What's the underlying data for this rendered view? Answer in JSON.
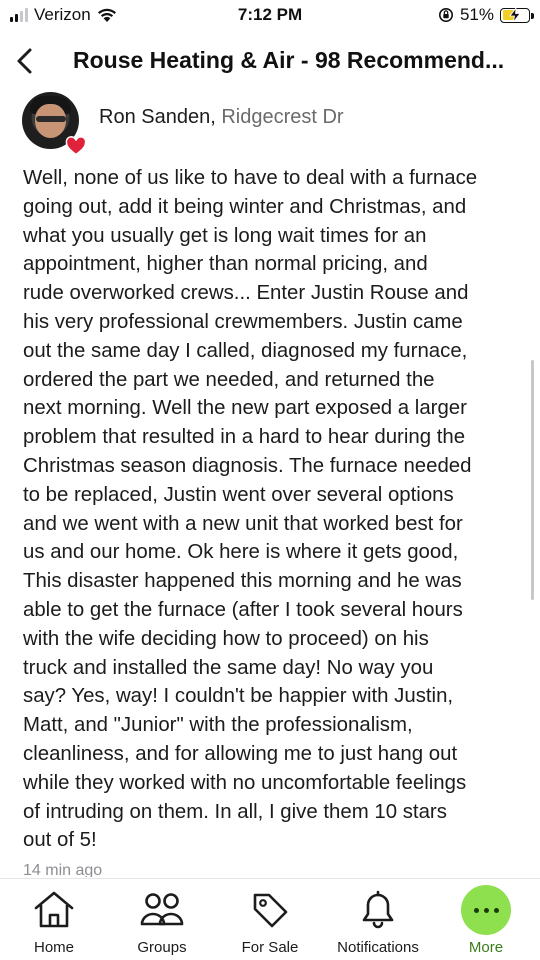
{
  "status_bar": {
    "carrier": "Verizon",
    "time": "7:12 PM",
    "battery_percent": "51%",
    "battery_level": 0.51,
    "signal_bars": 4,
    "signal_active": 2,
    "icons": [
      "signal-icon",
      "wifi-icon",
      "rotation-lock-icon",
      "battery-charging-icon"
    ]
  },
  "header": {
    "title": "Rouse Heating & Air - 98 Recommend...",
    "back_icon": "chevron-left-icon"
  },
  "author": {
    "name": "Ron Sanden",
    "separator": ",",
    "location": "Ridgecrest Dr",
    "badge_icon": "heart-icon",
    "badge_color": "#e0233a"
  },
  "post": {
    "lines": [
      "Well, none of us like to have to deal with a furnace",
      "going out, add it being winter and Christmas, and",
      "what you usually get is long wait times for an",
      "appointment, higher than normal pricing, and",
      "rude overworked crews... Enter Justin Rouse and",
      "his very professional crewmembers. Justin came",
      "out the same day I called, diagnosed my furnace,",
      "ordered the part we needed, and returned the",
      "next morning. Well the new part exposed a larger",
      "problem that resulted in a hard to hear during the",
      "Christmas season diagnosis. The furnace needed",
      "to be replaced, Justin went over several options",
      "and we went with a new unit that worked best for",
      "us and our home. Ok here is where it gets good,",
      "This disaster happened this morning and he was",
      "able to get the furnace (after I took several hours",
      "with the wife deciding how to proceed) on his",
      "truck and installed the same day! No way you",
      "say? Yes, way! I couldn't be happier with Justin,",
      "Matt, and \"Junior\" with the professionalism,",
      "cleanliness, and for allowing me to just hang out",
      "while they worked with no uncomfortable feelings",
      "of intruding on them. In all, I give them 10 stars",
      "out of 5!"
    ],
    "timestamp": "14 min ago"
  },
  "tabs": [
    {
      "label": "Home",
      "icon": "home-icon"
    },
    {
      "label": "Groups",
      "icon": "groups-icon"
    },
    {
      "label": "For Sale",
      "icon": "tag-icon"
    },
    {
      "label": "Notifications",
      "icon": "bell-icon"
    },
    {
      "label": "More",
      "icon": "more-icon",
      "accent": "#8ee04e",
      "label_color": "#3a7d1d"
    }
  ]
}
